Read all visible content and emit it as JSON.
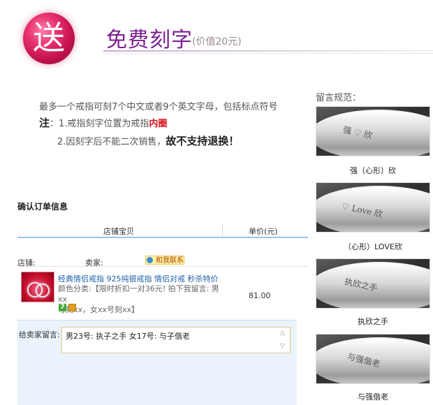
{
  "header": {
    "badge_char": "送",
    "title": "免费刻字",
    "price_note": "(价值20元)"
  },
  "info": {
    "line1": "最多一个戒指可刻7个中文或者9个英文字母，包括标点符号",
    "note_label": "注",
    "note1_prefix": "：1.戒指刻字位置为戒指",
    "note1_highlight": "内圈",
    "note2_prefix": "2.因刻字后不能二次销售，",
    "note2_bold": "故不支持退换！"
  },
  "order": {
    "section_title": "确认订单信息",
    "col_item": "店铺宝贝",
    "col_price": "单价(元)",
    "shop_label": "店铺:",
    "seller_label": "卖家:",
    "contact_label": "和我联系",
    "product_name": "经典情侣戒指 925纯银戒指 情侣对戒 秒杀特价 男...",
    "product_attr_line1": "颜色分类:【限时折扣一对36元! 拍下我留言: 男xx",
    "product_attr_line2": "号刻xx，女xx号刻xx】",
    "price": "81.00",
    "tag_label": "7",
    "message_label": "给卖家留言:",
    "message_value": "男23号: 执子之手    女17号: 与子偕老"
  },
  "examples": {
    "heading": "留言规范：",
    "items": [
      {
        "engraving": "强 ♡ 欣",
        "caption": "强（心形）欣"
      },
      {
        "engraving": "♡ Love 欣",
        "caption": "（心形）LOVE欣"
      },
      {
        "engraving": "执欣之手",
        "caption": "执欣之手"
      },
      {
        "engraving": "与强偕老",
        "caption": "与强偕老"
      }
    ]
  },
  "colors": {
    "title_purple": "#7a1f8f",
    "highlight_red": "#d6101c",
    "link_blue": "#1f5fa8",
    "message_bg": "#eaf3fb"
  }
}
